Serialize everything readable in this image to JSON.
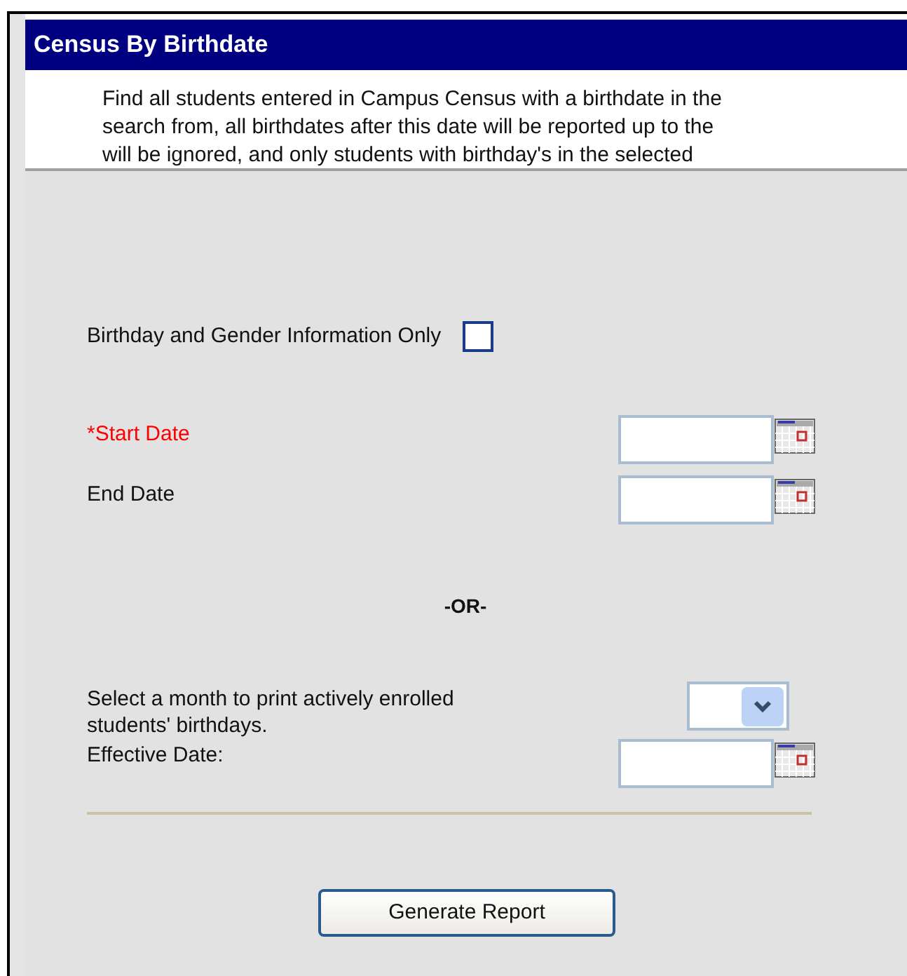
{
  "header": {
    "title": "Census By Birthdate"
  },
  "description": [
    "Find all students entered in Campus Census with a birthdate in the",
    "search from, all birthdates after this date will be reported up to the",
    "will be ignored, and only students with birthday's in the selected"
  ],
  "checkbox": {
    "label": "Birthday and Gender Information Only",
    "checked": false
  },
  "date_fields": [
    {
      "label": "*Start Date",
      "required": true
    },
    {
      "label": "End Date",
      "required": false
    }
  ],
  "separator": "-OR-",
  "month": {
    "label": "Select a month to print actively enrolled students' birthdays."
  },
  "effective_date": {
    "label": "Effective Date:"
  },
  "button": "Generate Report"
}
